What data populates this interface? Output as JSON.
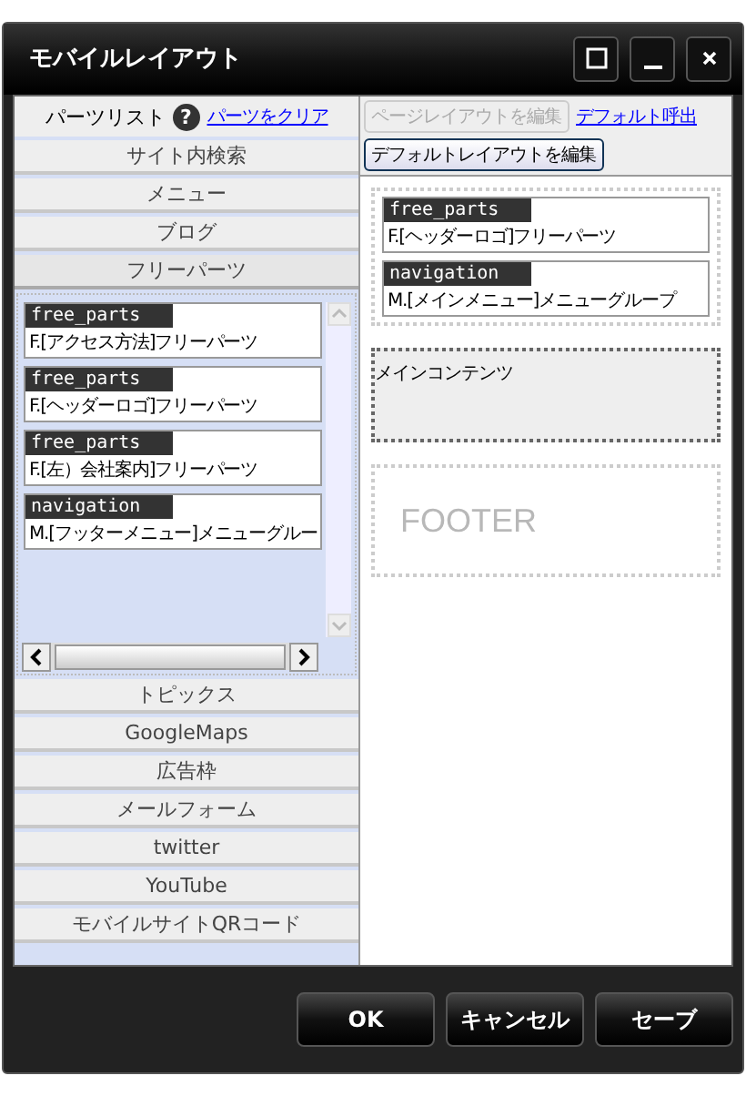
{
  "window": {
    "title": "モバイルレイアウト"
  },
  "parts_list": {
    "title": "パーツリスト",
    "help": "?",
    "clear_link": "パーツをクリア",
    "categories": [
      {
        "label": "サイト内検索",
        "expanded": false
      },
      {
        "label": "メニュー",
        "expanded": false
      },
      {
        "label": "ブログ",
        "expanded": false
      },
      {
        "label": "フリーパーツ",
        "expanded": true,
        "parts": [
          {
            "type": "free_parts",
            "name": "F.[アクセス方法]フリーパーツ"
          },
          {
            "type": "free_parts",
            "name": "F.[ヘッダーロゴ]フリーパーツ"
          },
          {
            "type": "free_parts",
            "name": "F.[左）会社案内]フリーパーツ"
          },
          {
            "type": "navigation",
            "name": "M.[フッターメニュー]メニューグルー"
          }
        ]
      },
      {
        "label": "トピックス",
        "expanded": false
      },
      {
        "label": "GoogleMaps",
        "expanded": false
      },
      {
        "label": "広告枠",
        "expanded": false
      },
      {
        "label": "メールフォーム",
        "expanded": false
      },
      {
        "label": "twitter",
        "expanded": false
      },
      {
        "label": "YouTube",
        "expanded": false
      },
      {
        "label": "モバイルサイトQRコード",
        "expanded": false
      }
    ]
  },
  "layout_editor": {
    "page_button": {
      "label": "ページレイアウトを編集",
      "disabled": true
    },
    "default_link": "デフォルト呼出",
    "default_button": {
      "label": "デフォルトレイアウトを編集",
      "disabled": false
    },
    "zones": [
      {
        "kind": "header",
        "parts": [
          {
            "type": "free_parts",
            "name": "F.[ヘッダーロゴ]フリーパーツ"
          },
          {
            "type": "navigation",
            "name": "M.[メインメニュー]メニューグループ"
          }
        ]
      },
      {
        "kind": "main",
        "label": "メインコンテンツ"
      },
      {
        "kind": "footer",
        "label": "FOOTER"
      }
    ]
  },
  "buttons": [
    "OK",
    "キャンセル",
    "セーブ"
  ]
}
